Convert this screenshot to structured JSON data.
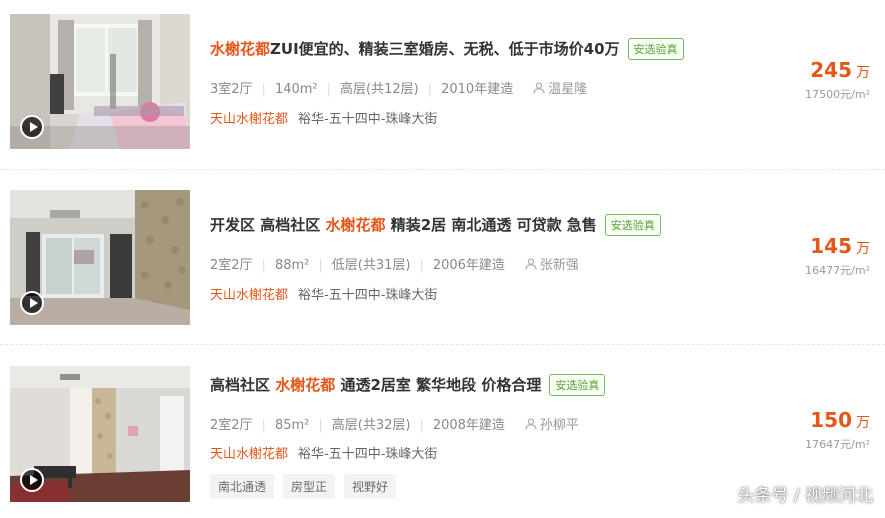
{
  "listings": [
    {
      "title_highlight": "水榭花都",
      "title_rest": "ZUI便宜的、精装三室婚房、无税、低于市场价40万",
      "badge": "安选验真",
      "layout": "3室2厅",
      "size": "140m²",
      "floor": "高层(共12层)",
      "built": "2010年建造",
      "agent": "温星隆",
      "community": "天山水榭花都",
      "area": "裕华-五十四中-珠峰大街",
      "price_total": "245",
      "price_unit": "万",
      "price_per": "17500元/m²",
      "tags": []
    },
    {
      "title_before": "开发区 高档社区 ",
      "title_highlight": "水榭花都",
      "title_rest": " 精装2居 南北通透 可贷款 急售",
      "badge": "安选验真",
      "layout": "2室2厅",
      "size": "88m²",
      "floor": "低层(共31层)",
      "built": "2006年建造",
      "agent": "张新强",
      "community": "天山水榭花都",
      "area": "裕华-五十四中-珠峰大街",
      "price_total": "145",
      "price_unit": "万",
      "price_per": "16477元/m²",
      "tags": []
    },
    {
      "title_before": "高档社区 ",
      "title_highlight": "水榭花都",
      "title_rest": " 通透2居室 繁华地段 价格合理",
      "badge": "安选验真",
      "layout": "2室2厅",
      "size": "85m²",
      "floor": "高层(共32层)",
      "built": "2008年建造",
      "agent": "孙柳平",
      "community": "天山水榭花都",
      "area": "裕华-五十四中-珠峰大街",
      "price_total": "150",
      "price_unit": "万",
      "price_per": "17647元/m²",
      "tags": [
        "南北通透",
        "房型正",
        "视野好"
      ]
    }
  ],
  "watermark": "头条号 / 视频河北",
  "colors": {
    "accent": "#e4571b",
    "badge_green": "#52a62e"
  },
  "icons": {
    "play": "play-icon",
    "agent": "user-icon"
  }
}
